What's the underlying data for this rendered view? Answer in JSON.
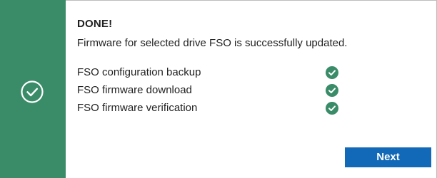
{
  "dialog": {
    "title": "DONE!",
    "message": "Firmware for selected drive FSO is successfully updated.",
    "status_icon": "check-circle-icon",
    "steps": [
      {
        "label": "FSO configuration backup",
        "status": "success",
        "icon": "check-icon"
      },
      {
        "label": "FSO firmware download",
        "status": "success",
        "icon": "check-icon"
      },
      {
        "label": "FSO firmware verification",
        "status": "success",
        "icon": "check-icon"
      }
    ],
    "next_label": "Next"
  },
  "colors": {
    "stripe": "#3a8b67",
    "success": "#3a8b67",
    "button": "#1269b7",
    "button_text": "#ffffff",
    "text": "#1f1f1f"
  }
}
